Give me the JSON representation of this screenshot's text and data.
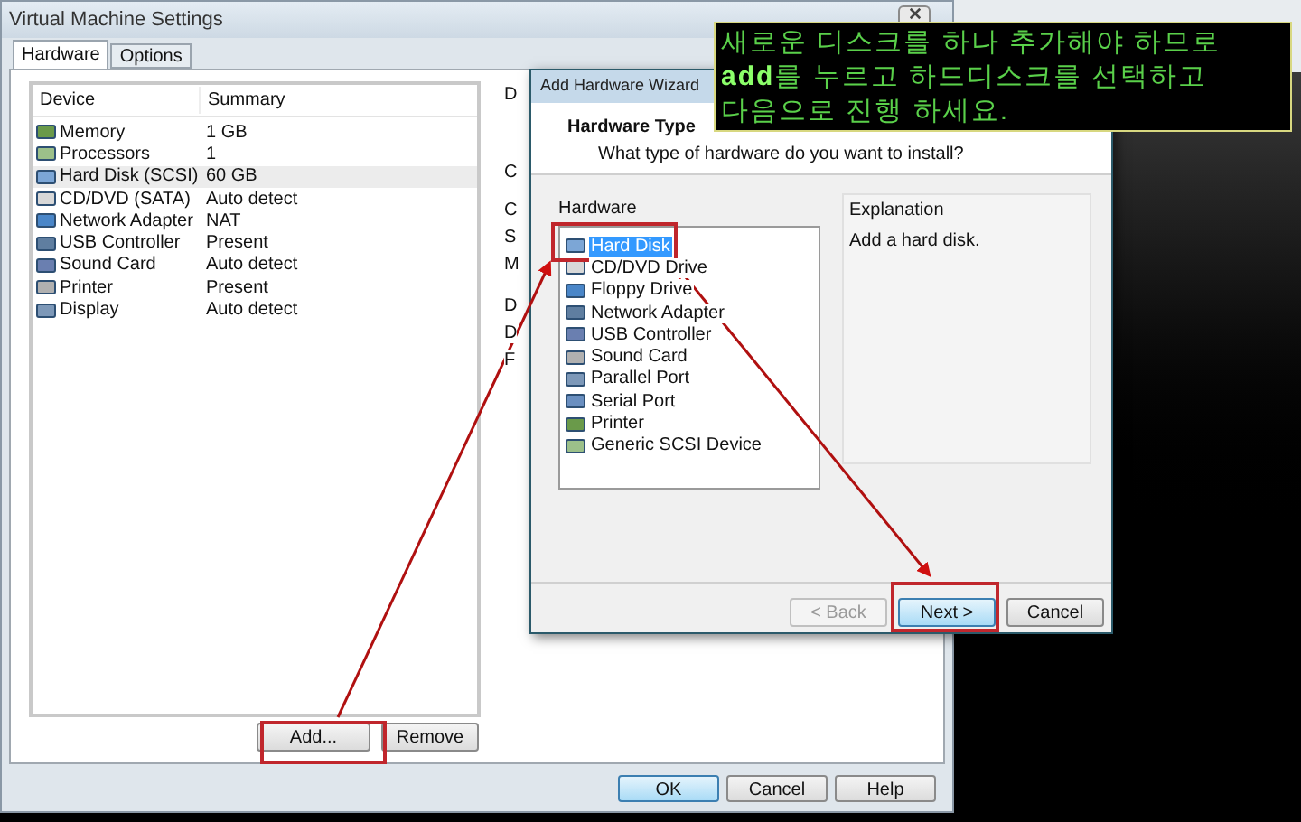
{
  "window": {
    "title": "Virtual Machine Settings"
  },
  "tabs": [
    {
      "label": "Hardware",
      "selected": true
    },
    {
      "label": "Options",
      "selected": false
    }
  ],
  "device_table": {
    "columns": [
      "Device",
      "Summary"
    ],
    "rows": [
      {
        "device": "Memory",
        "summary": "1 GB",
        "selected": false
      },
      {
        "device": "Processors",
        "summary": "1",
        "selected": false
      },
      {
        "device": "Hard Disk (SCSI)",
        "summary": "60 GB",
        "selected": true
      },
      {
        "device": "CD/DVD (SATA)",
        "summary": "Auto detect",
        "selected": false
      },
      {
        "device": "Network Adapter",
        "summary": "NAT",
        "selected": false
      },
      {
        "device": "USB Controller",
        "summary": "Present",
        "selected": false
      },
      {
        "device": "Sound Card",
        "summary": "Auto detect",
        "selected": false
      },
      {
        "device": "Printer",
        "summary": "Present",
        "selected": false
      },
      {
        "device": "Display",
        "summary": "Auto detect",
        "selected": false
      }
    ]
  },
  "right_panel_fragments": [
    "D",
    "C",
    "C",
    "S",
    "M",
    "D",
    "D",
    "F"
  ],
  "list_buttons": [
    "Add...",
    "Remove"
  ],
  "dialog_buttons": [
    {
      "label": "OK",
      "default": true
    },
    {
      "label": "Cancel",
      "default": false
    },
    {
      "label": "Help",
      "default": false
    }
  ],
  "wizard": {
    "title": "Add Hardware Wizard",
    "heading": "Hardware Type",
    "subtitle": "What type of hardware do you want to install?",
    "list_label": "Hardware",
    "items": [
      {
        "label": "Hard Disk",
        "selected": true
      },
      {
        "label": "CD/DVD Drive",
        "selected": false
      },
      {
        "label": "Floppy Drive",
        "selected": false
      },
      {
        "label": "Network Adapter",
        "selected": false
      },
      {
        "label": "USB Controller",
        "selected": false
      },
      {
        "label": "Sound Card",
        "selected": false
      },
      {
        "label": "Parallel Port",
        "selected": false
      },
      {
        "label": "Serial Port",
        "selected": false
      },
      {
        "label": "Printer",
        "selected": false
      },
      {
        "label": "Generic SCSI Device",
        "selected": false
      }
    ],
    "explanation_label": "Explanation",
    "explanation": "Add a hard disk.",
    "buttons": [
      {
        "label": "< Back",
        "disabled": true,
        "default": false
      },
      {
        "label": "Next >",
        "disabled": false,
        "default": true
      },
      {
        "label": "Cancel",
        "disabled": false,
        "default": false
      }
    ]
  },
  "callout": {
    "lines": [
      "새로운 디스크를 하나 추가해야 하므로",
      "**add**를 누르고 하드디스크를 선택하고",
      "다음으로 진행 하세요."
    ]
  }
}
